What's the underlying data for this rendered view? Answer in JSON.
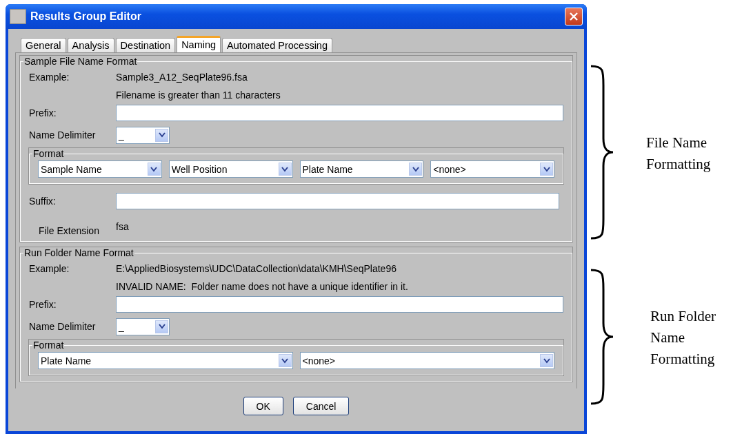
{
  "window": {
    "title": "Results Group Editor"
  },
  "tabs": [
    {
      "label": "General",
      "selected": false
    },
    {
      "label": "Analysis",
      "selected": false
    },
    {
      "label": "Destination",
      "selected": false
    },
    {
      "label": "Naming",
      "selected": true
    },
    {
      "label": "Automated Processing",
      "selected": false
    }
  ],
  "sections": [
    {
      "title": "Sample File Name Format",
      "example_label": "Example:",
      "example": "Sample3_A12_SeqPlate96.fsa",
      "message": "Filename is greater than 11 characters",
      "prefix_label": "Prefix:",
      "delimiter_label": "Name Delimiter",
      "delimiter": "_",
      "format_title": "Format",
      "format": [
        "Sample Name",
        "Well Position",
        "Plate Name",
        "<none>"
      ],
      "suffix_label": "Suffix:",
      "extension_label": "File Extension",
      "extension": "fsa"
    },
    {
      "title": "Run Folder Name Format",
      "example_label": "Example:",
      "example": "E:\\AppliedBiosystems\\UDC\\DataCollection\\data\\KMH\\SeqPlate96",
      "message": "INVALID NAME:  Folder name does not have a unique identifier in it.",
      "prefix_label": "Prefix:",
      "delimiter_label": "Name Delimiter",
      "delimiter": "_",
      "format_title": "Format",
      "format": [
        "Plate Name",
        "<none>"
      ]
    }
  ],
  "buttons": [
    "OK",
    "Cancel"
  ],
  "annotations": [
    "File Name Formatting",
    "Run Folder Name Formatting"
  ]
}
